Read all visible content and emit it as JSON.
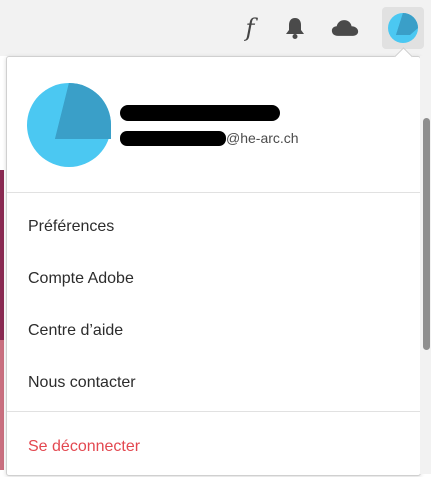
{
  "toolbar": {
    "icons": [
      "fonts-icon",
      "bell-icon",
      "cloud-icon",
      "avatar-icon"
    ],
    "fonts_glyph": "f"
  },
  "profile": {
    "email_suffix": "@he-arc.ch",
    "avatar_color": "#4bc8f2",
    "avatar_shade": "#3a9fc8"
  },
  "menu": {
    "items": [
      {
        "label": "Préférences"
      },
      {
        "label": "Compte Adobe"
      },
      {
        "label": "Centre d’aide"
      },
      {
        "label": "Nous contacter"
      }
    ],
    "logout_label": "Se déconnecter"
  },
  "colors": {
    "accent_red": "#e34850",
    "toolbar_bg": "#f2f2f2"
  }
}
